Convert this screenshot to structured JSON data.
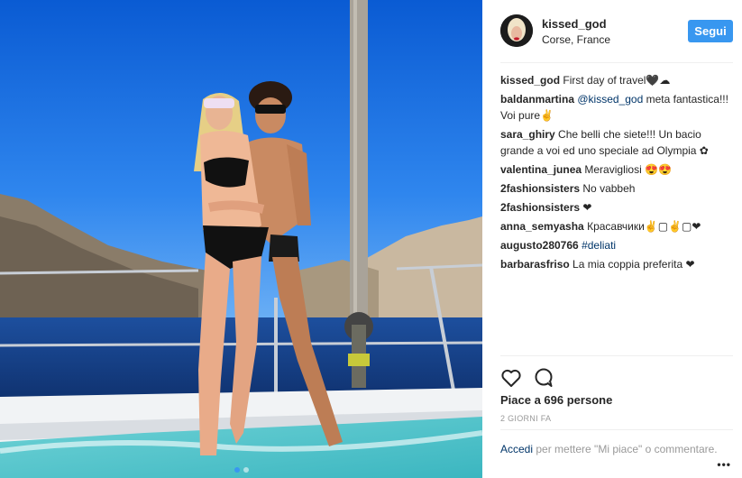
{
  "post": {
    "username": "kissed_god",
    "location": "Corse, France",
    "follow_label": "Segui",
    "likes": "Piace a 696 persone",
    "time": "2 GIORNI FA",
    "login_link": "Accedi",
    "login_text": " per mettere \"Mi piace\" o commentare.",
    "more": "•••",
    "carousel": {
      "count": 2,
      "active": 1
    }
  },
  "comments": [
    {
      "user": "kissed_god",
      "text": "First day of travel🖤☁"
    },
    {
      "user": "baldanmartina",
      "mention": "@kissed_god",
      "text": " meta fantastica!!! Voi pure✌"
    },
    {
      "user": "sara_ghiry",
      "text": "Che belli che siete!!! Un bacio grande a voi ed uno speciale ad Olympia ✿"
    },
    {
      "user": "valentina_junea",
      "text": "Meravigliosi 😍😍"
    },
    {
      "user": "2fashionsisters",
      "text": "No vabbeh"
    },
    {
      "user": "2fashionsisters",
      "text": "❤"
    },
    {
      "user": "anna_semyasha",
      "text": "Красавчики✌▢✌▢❤"
    },
    {
      "user": "augusto280766",
      "hashtag": "#deliati",
      "text": ""
    },
    {
      "user": "barbarasfriso",
      "text": "La mia coppia preferita ❤"
    }
  ],
  "icons": [
    "heart-icon",
    "comment-icon"
  ],
  "colors": {
    "accent": "#3897f0",
    "link": "#003569",
    "muted": "#999999"
  }
}
